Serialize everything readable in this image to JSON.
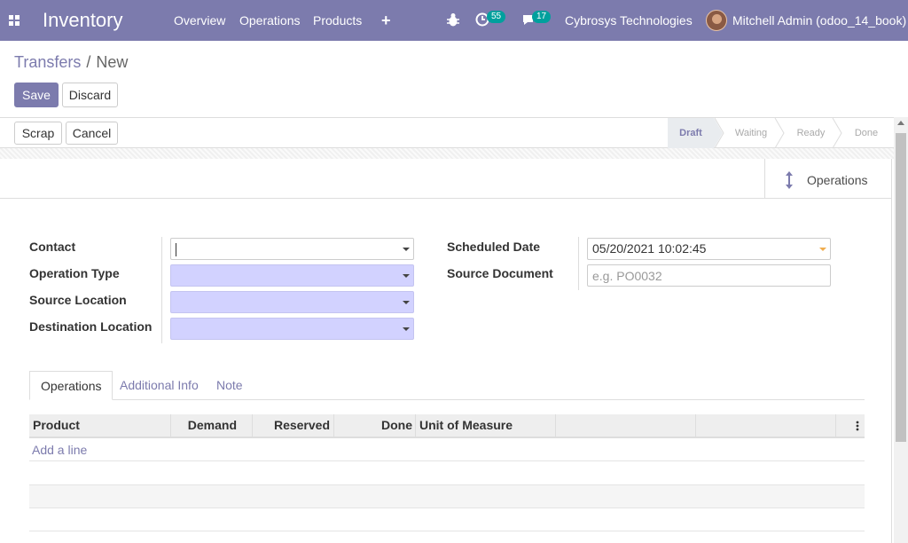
{
  "navbar": {
    "app_title": "Inventory",
    "menu": [
      "Overview",
      "Operations",
      "Products"
    ],
    "plus_icon": "+",
    "activity_count": "55",
    "message_count": "17",
    "company": "Cybrosys Technologies",
    "user": "Mitchell Admin (odoo_14_book)"
  },
  "breadcrumb": {
    "parent": "Transfers",
    "separator": "/",
    "current": "New"
  },
  "actions": {
    "save": "Save",
    "discard": "Discard"
  },
  "header_buttons": {
    "scrap": "Scrap",
    "cancel": "Cancel"
  },
  "status": {
    "stages": [
      "Draft",
      "Waiting",
      "Ready",
      "Done"
    ],
    "active": "Draft"
  },
  "smart_button": {
    "label": "Operations",
    "icon": "arrows-v-icon"
  },
  "form": {
    "contact_label": "Contact",
    "operation_type_label": "Operation Type",
    "source_location_label": "Source Location",
    "destination_location_label": "Destination Location",
    "scheduled_date_label": "Scheduled Date",
    "scheduled_date_value": "05/20/2021 10:02:45",
    "source_document_label": "Source Document",
    "source_document_placeholder": "e.g. PO0032"
  },
  "tabs": [
    "Operations",
    "Additional Info",
    "Note"
  ],
  "table": {
    "columns": [
      "Product",
      "Demand",
      "Reserved",
      "Done",
      "Unit of Measure"
    ],
    "add_line": "Add a line"
  },
  "colors": {
    "brand": "#7c7bad",
    "badge": "#00a09d",
    "required_field": "#d2d2ff"
  }
}
